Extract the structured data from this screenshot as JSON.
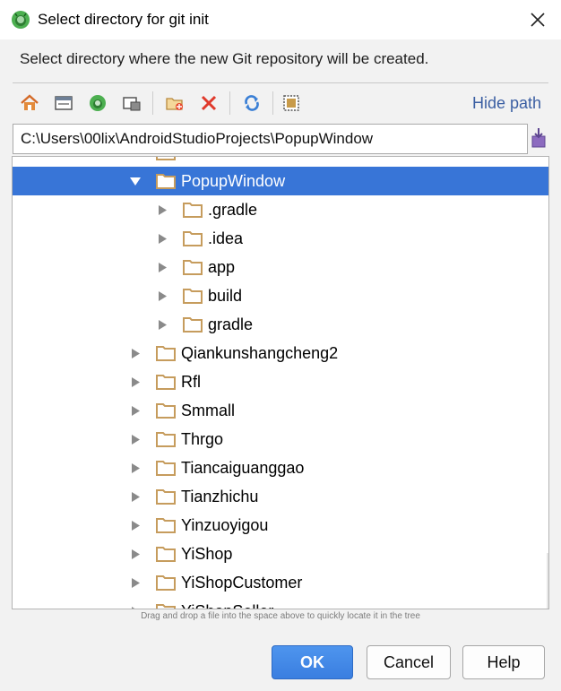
{
  "window": {
    "title": "Select directory for git init",
    "close_icon": "close-icon"
  },
  "description": "Select directory where the new Git repository will be created.",
  "toolbar": {
    "buttons": [
      {
        "name": "home-icon"
      },
      {
        "name": "desktop-icon"
      },
      {
        "name": "project-icon"
      },
      {
        "name": "module-icon"
      },
      {
        "name": "new-folder-icon"
      },
      {
        "name": "delete-icon"
      },
      {
        "name": "refresh-icon"
      },
      {
        "name": "show-hidden-icon"
      }
    ],
    "hide_path_label": "Hide path"
  },
  "path_field": {
    "value": "C:\\Users\\00lix\\AndroidStudioProjects\\PopupWindow"
  },
  "tree": {
    "partial_top_label": "...",
    "items": [
      {
        "label": "PopupWindow",
        "depth": 0,
        "expanded": true,
        "selected": true
      },
      {
        "label": ".gradle",
        "depth": 1,
        "expanded": false,
        "selected": false
      },
      {
        "label": ".idea",
        "depth": 1,
        "expanded": false,
        "selected": false
      },
      {
        "label": "app",
        "depth": 1,
        "expanded": false,
        "selected": false
      },
      {
        "label": "build",
        "depth": 1,
        "expanded": false,
        "selected": false
      },
      {
        "label": "gradle",
        "depth": 1,
        "expanded": false,
        "selected": false
      },
      {
        "label": "Qiankunshangcheng2",
        "depth": 0,
        "expanded": false,
        "selected": false
      },
      {
        "label": "Rfl",
        "depth": 0,
        "expanded": false,
        "selected": false
      },
      {
        "label": "Smmall",
        "depth": 0,
        "expanded": false,
        "selected": false
      },
      {
        "label": "Thrgo",
        "depth": 0,
        "expanded": false,
        "selected": false
      },
      {
        "label": "Tiancaiguanggao",
        "depth": 0,
        "expanded": false,
        "selected": false
      },
      {
        "label": "Tianzhichu",
        "depth": 0,
        "expanded": false,
        "selected": false
      },
      {
        "label": "Yinzuoyigou",
        "depth": 0,
        "expanded": false,
        "selected": false
      },
      {
        "label": "YiShop",
        "depth": 0,
        "expanded": false,
        "selected": false
      },
      {
        "label": "YiShopCustomer",
        "depth": 0,
        "expanded": false,
        "selected": false
      },
      {
        "label": "YiShopSeller",
        "depth": 0,
        "expanded": false,
        "selected": false
      }
    ]
  },
  "hint": "Drag and drop a file into the space above to quickly locate it in the tree",
  "buttons": {
    "ok": "OK",
    "cancel": "Cancel",
    "help": "Help"
  },
  "colors": {
    "selection": "#3875d7",
    "folder": "#c69c5d",
    "link": "#3b5fa3",
    "ok_button": "#3a7ee0"
  }
}
